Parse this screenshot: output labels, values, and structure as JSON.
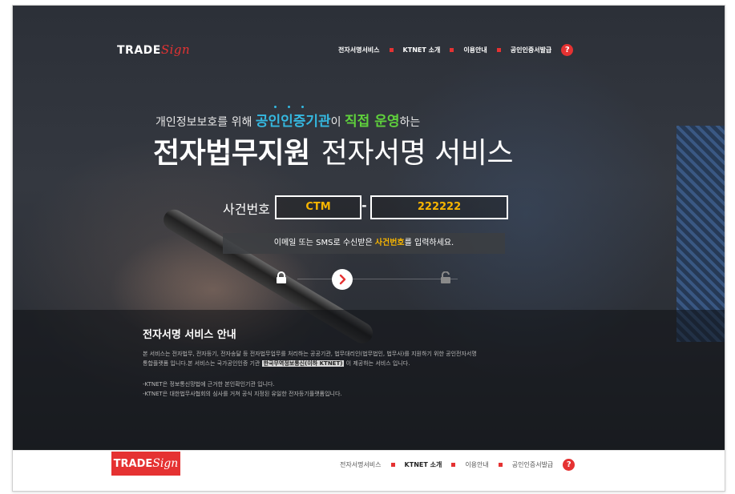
{
  "brand": {
    "part1": "TRADE",
    "part2": "Sign"
  },
  "nav": {
    "items": [
      "전자서명서비스",
      "KTNET 소개",
      "이용안내",
      "공인인증서발급"
    ],
    "help": "?"
  },
  "hero": {
    "tagline_pre": "개인정보보호를 위해 ",
    "tagline_hl1": "공인인증기관",
    "tagline_mid": "이 ",
    "tagline_hl2": "직접 운영",
    "tagline_post": "하는",
    "title_bold": "전자법무지원",
    "title_rest": "전자서명 서비스"
  },
  "case": {
    "label": "사건번호",
    "prefix": "CTM",
    "dash": "-",
    "number": "222222"
  },
  "hint": {
    "pre": "이메일 또는 SMS로 수신받은 ",
    "em": "사건번호",
    "post": "를 입력하세요."
  },
  "info": {
    "title": "전자서명 서비스 안내",
    "line1": "본 서비스는 전자법무, 전자등기, 전자송달 등 전자법무업무를 처리하는 공공기관, 법무대리인(법무법인, 법무사)를 지원하기 위한 공인전자서명",
    "line2_pre": "통합플랫폼 입니다.본 서비스는 국가공인인증 기관 ",
    "line2_hl": "한국무역정보통신(이하 KTNET)",
    "line2_post": " 이 제공하는 서비스 입니다.",
    "note1": "-KTNET은 정보통신망법에 근거한 본인확인기관 입니다.",
    "note2": "-KTNET은 대한법무사협회의 심사를 거쳐 공식 지정된 유일한 전자등기플랫폼입니다."
  },
  "colors": {
    "accent": "#e53232",
    "case_text": "#f7b500",
    "cyan": "#35b8e0",
    "green": "#5fd13c"
  }
}
